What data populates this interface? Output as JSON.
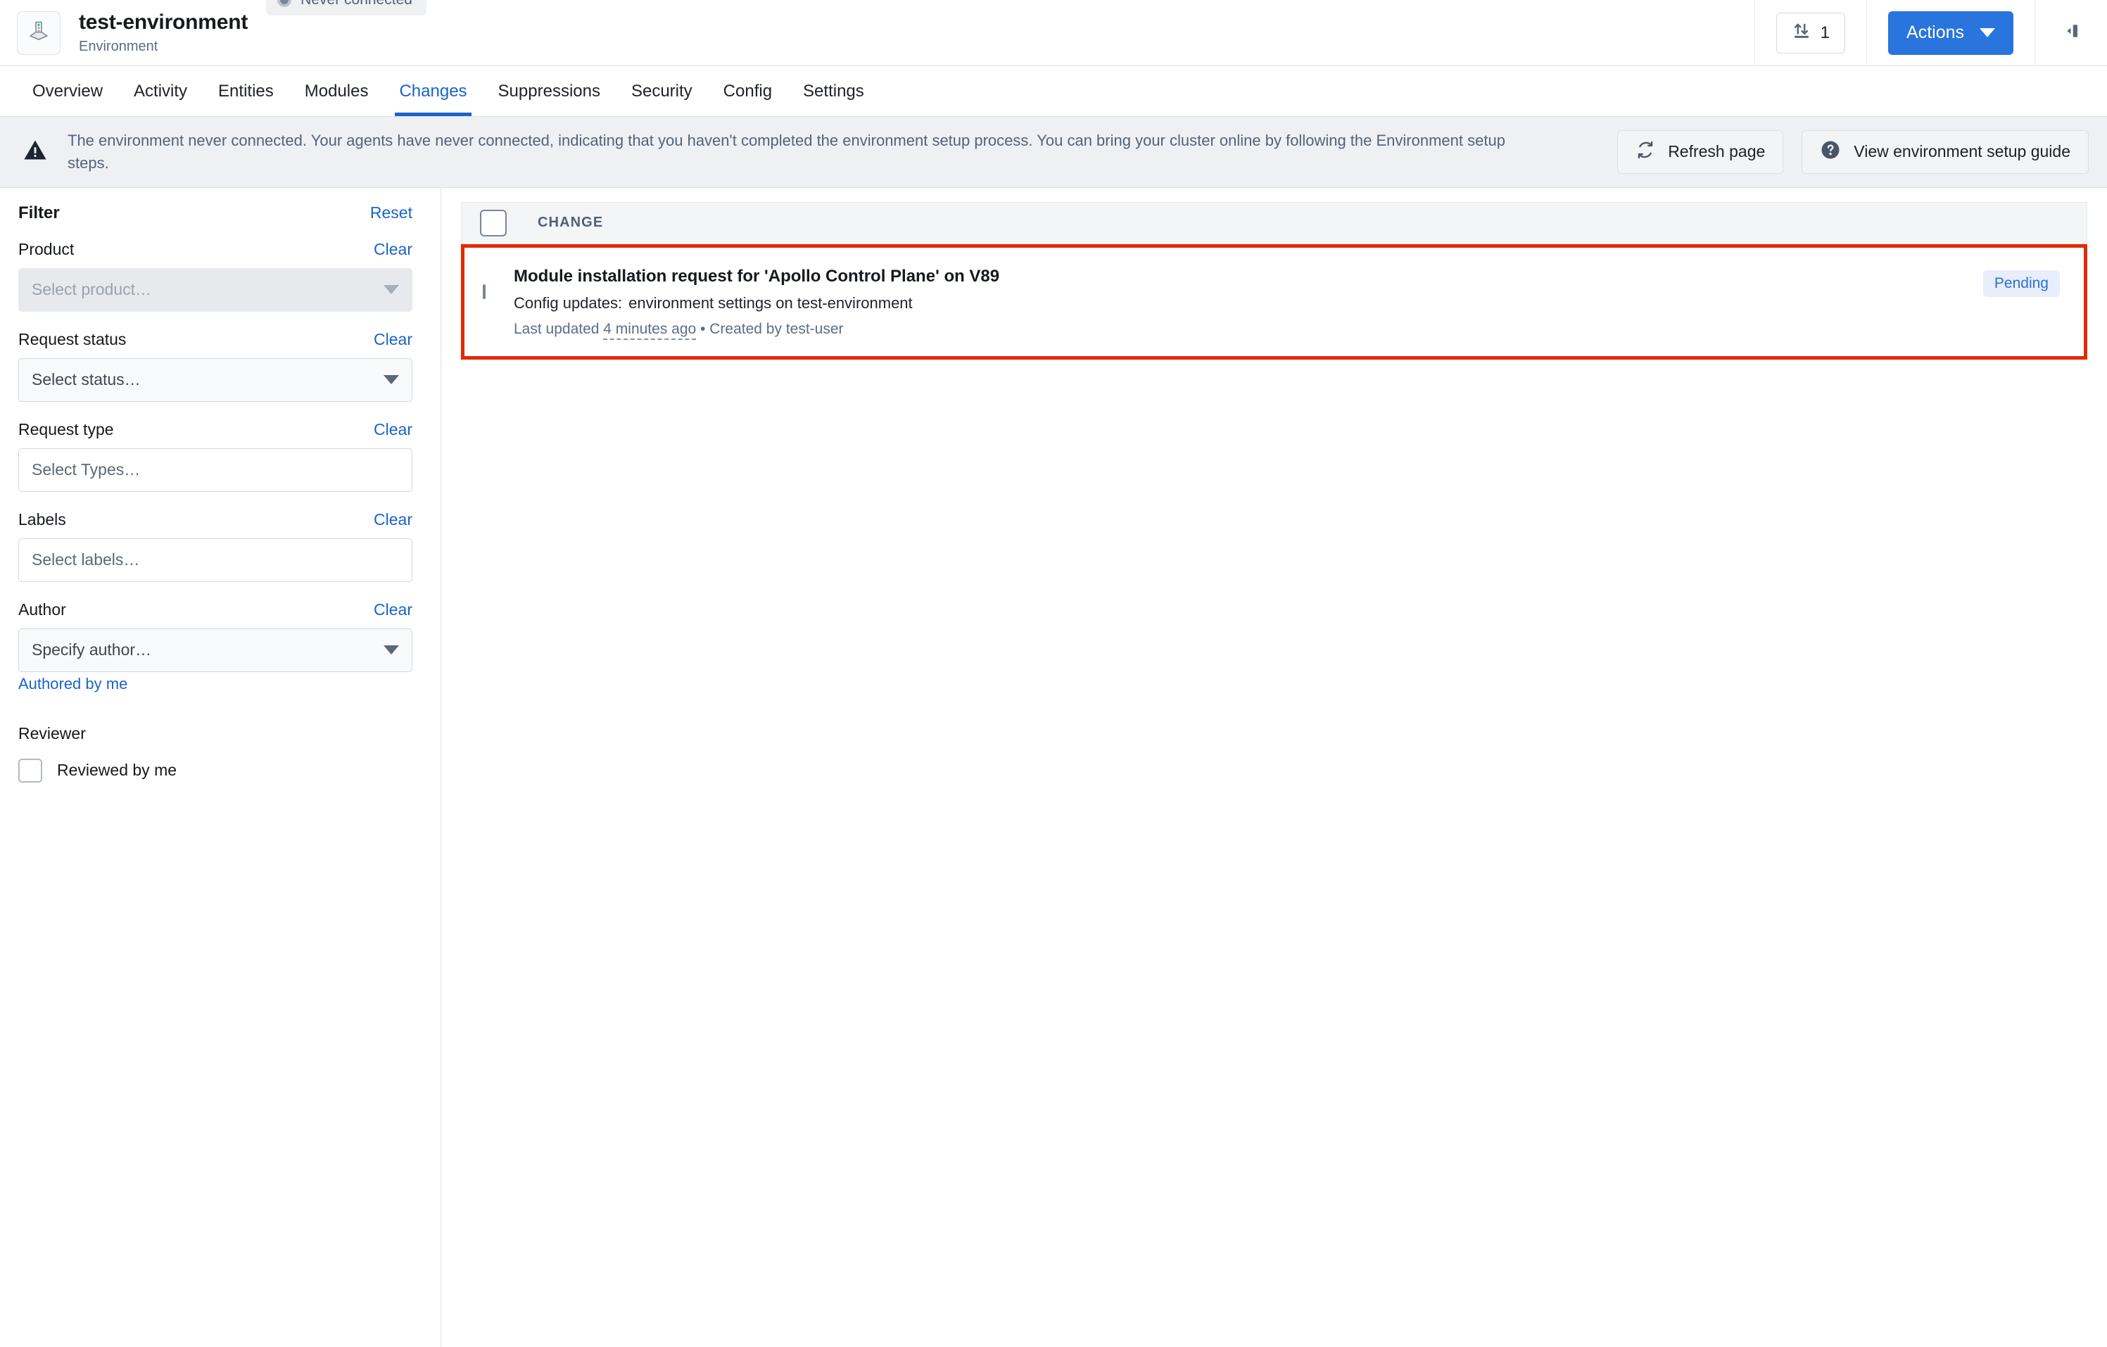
{
  "header": {
    "env_icon": "server-rack-icon",
    "title": "test-environment",
    "subtitle": "Environment",
    "status_label": "Never connected",
    "status_color": "#7a8699",
    "count_icon": "sort-updown-icon",
    "count_value": "1",
    "actions_label": "Actions",
    "collapse_icon": "collapse-panel-icon",
    "accent_color": "#2a74dd"
  },
  "nav": {
    "tabs": [
      {
        "label": "Overview",
        "active": false
      },
      {
        "label": "Activity",
        "active": false
      },
      {
        "label": "Entities",
        "active": false
      },
      {
        "label": "Modules",
        "active": false
      },
      {
        "label": "Changes",
        "active": true
      },
      {
        "label": "Suppressions",
        "active": false
      },
      {
        "label": "Security",
        "active": false
      },
      {
        "label": "Config",
        "active": false
      },
      {
        "label": "Settings",
        "active": false
      }
    ]
  },
  "banner": {
    "icon": "warning-triangle-icon",
    "text": "The environment never connected. Your agents have never connected, indicating that you haven't completed the environment setup process. You can bring your cluster online by following the Environment setup steps.",
    "refresh_label": "Refresh page",
    "refresh_icon": "refresh-icon",
    "guide_label": "View environment setup guide",
    "guide_icon": "question-circle-icon",
    "background": "#eef0f3"
  },
  "filter": {
    "title": "Filter",
    "reset_label": "Reset",
    "groups": [
      {
        "label": "Product",
        "clear_label": "Clear",
        "placeholder": "Select product…",
        "disabled": true,
        "caret": true
      },
      {
        "label": "Request status",
        "clear_label": "Clear",
        "placeholder": "Select status…",
        "disabled": false,
        "caret": true
      },
      {
        "label": "Request type",
        "clear_label": "Clear",
        "placeholder": "Select Types…",
        "disabled": false,
        "caret": false
      },
      {
        "label": "Labels",
        "clear_label": "Clear",
        "placeholder": "Select labels…",
        "disabled": false,
        "caret": false
      },
      {
        "label": "Author",
        "clear_label": "Clear",
        "placeholder": "Specify author…",
        "disabled": false,
        "caret": true
      }
    ],
    "authored_by_me": "Authored by me",
    "reviewer_label": "Reviewer",
    "reviewed_by_me": "Reviewed by me",
    "reviewed_checked": false
  },
  "changes_table": {
    "column_header": "CHANGE",
    "select_all_checked": false,
    "rows": [
      {
        "checked": false,
        "title": "Module installation request for 'Apollo Control Plane' on V89",
        "subtitle_prefix": "Config updates:",
        "subtitle_detail": "environment settings on test-environment",
        "meta_prefix": "Last updated",
        "meta_time": "4 minutes ago",
        "meta_separator": "•",
        "meta_author": "Created by test-user",
        "status_badge": "Pending",
        "status_badge_color": "#2a6fd4",
        "status_badge_bg": "#e8eefb",
        "highlighted": true,
        "highlight_color": "#e02b05"
      }
    ]
  }
}
